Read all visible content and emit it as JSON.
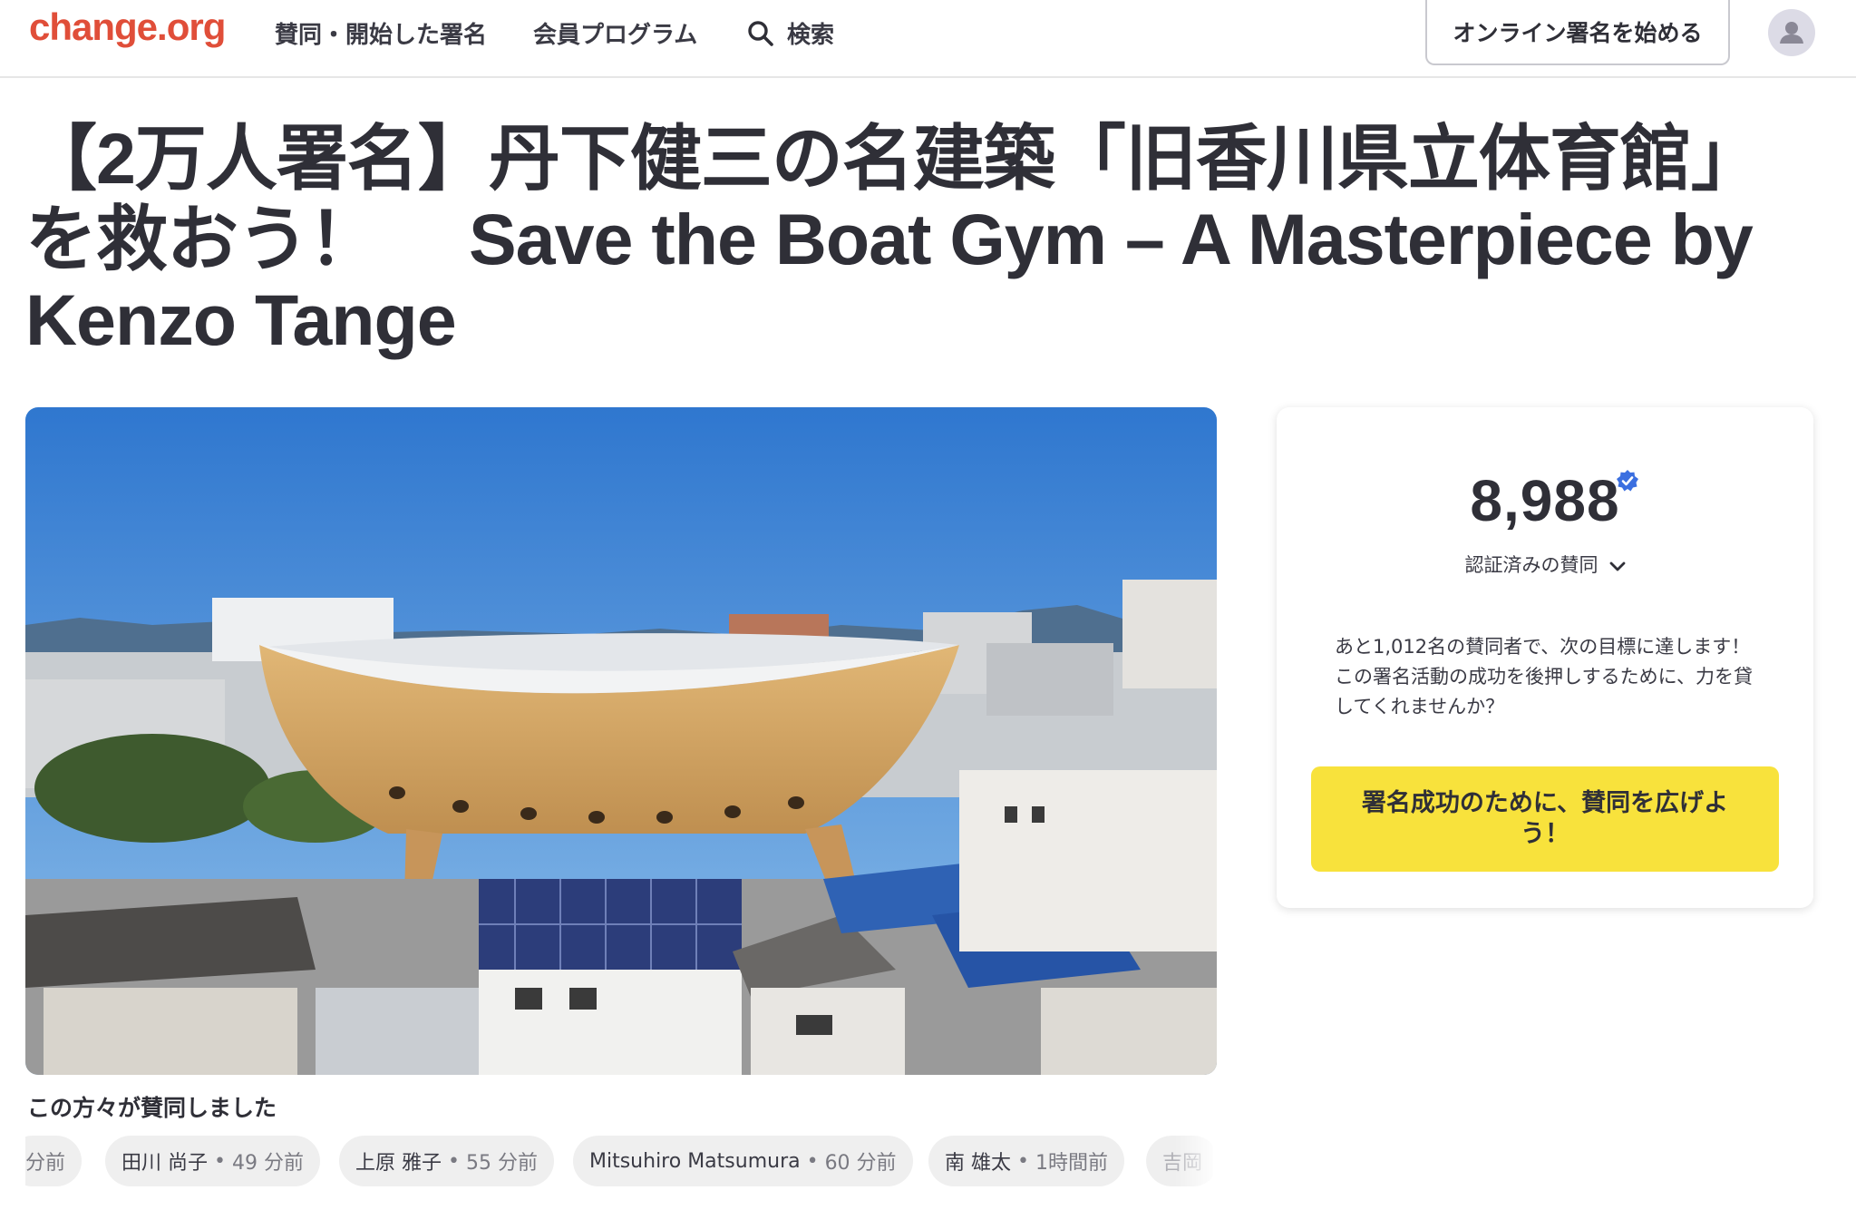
{
  "header": {
    "logo": "change.org",
    "nav": [
      "賛同・開始した署名",
      "会員プログラム"
    ],
    "search_label": "検索",
    "start_button": "オンライン署名を始める",
    "avatar_icon": "user-icon",
    "search_icon": "search-icon"
  },
  "petition": {
    "title": "【2万人署名】丹下健三の名建築「旧香川県立体育館」を救おう！　 Save the Boat Gym – A Masterpiece by Kenzo Tange"
  },
  "panel": {
    "count": "8,988",
    "verified_icon": "verified-badge-icon",
    "verified_label": "認証済みの賛同",
    "chevron_icon": "chevron-down-icon",
    "goal_text": "あと1,012名の賛同者で、次の目標に達します！この署名活動の成功を後押しするために、力を貸してくれませんか？",
    "cta_button": "署名成功のために、賛同を広げよう！",
    "cta_color": "#f8e23c"
  },
  "signers": {
    "heading": "この方々が賛同しました",
    "items": [
      {
        "name": "",
        "time": "分前"
      },
      {
        "name": "田川 尚子",
        "time": "49 分前"
      },
      {
        "name": "上原 雅子",
        "time": "55 分前"
      },
      {
        "name": "Mitsuhiro Matsumura",
        "time": "60 分前"
      },
      {
        "name": "南 雄太",
        "time": "1時間前"
      },
      {
        "name": "吉岡",
        "time": ""
      }
    ]
  },
  "colors": {
    "brand": "#e04e39",
    "text": "#2f2f37",
    "verified": "#3b6fe0"
  }
}
